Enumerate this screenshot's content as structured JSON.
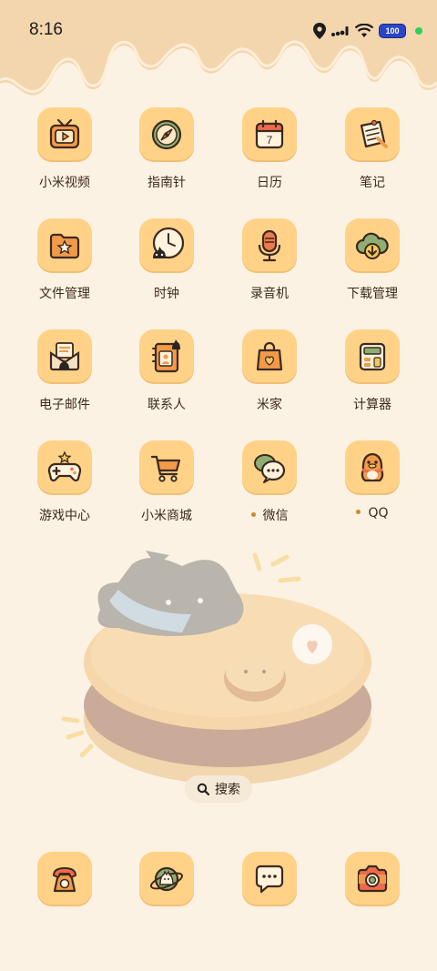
{
  "status_bar": {
    "time": "8:16",
    "battery": "100",
    "icons": [
      "location-icon",
      "signal-icon",
      "wifi-icon",
      "battery-icon",
      "privacy-dot"
    ]
  },
  "apps": [
    {
      "label": "小米视频",
      "icon": "tv-icon"
    },
    {
      "label": "指南针",
      "icon": "compass-icon"
    },
    {
      "label": "日历",
      "icon": "calendar-icon",
      "day": "7"
    },
    {
      "label": "笔记",
      "icon": "notes-icon"
    },
    {
      "label": "文件管理",
      "icon": "folder-icon"
    },
    {
      "label": "时钟",
      "icon": "clock-icon"
    },
    {
      "label": "录音机",
      "icon": "microphone-icon"
    },
    {
      "label": "下载管理",
      "icon": "download-cloud-icon"
    },
    {
      "label": "电子邮件",
      "icon": "mail-icon"
    },
    {
      "label": "联系人",
      "icon": "contacts-icon"
    },
    {
      "label": "米家",
      "icon": "shopping-bag-icon"
    },
    {
      "label": "计算器",
      "icon": "calculator-icon"
    },
    {
      "label": "游戏中心",
      "icon": "gamepad-icon"
    },
    {
      "label": "小米商城",
      "icon": "cart-icon"
    },
    {
      "label": "微信",
      "icon": "chat-bubbles-icon"
    },
    {
      "label": "QQ",
      "icon": "penguin-icon"
    }
  ],
  "search": {
    "label": "搜索",
    "icon": "search-icon"
  },
  "dock": [
    {
      "icon": "phone-icon"
    },
    {
      "icon": "planet-cat-icon"
    },
    {
      "icon": "message-icon"
    },
    {
      "icon": "camera-icon"
    }
  ],
  "colors": {
    "background": "#fcf2e3",
    "tile": "#ffd288",
    "drip": "#f4d6ae"
  }
}
